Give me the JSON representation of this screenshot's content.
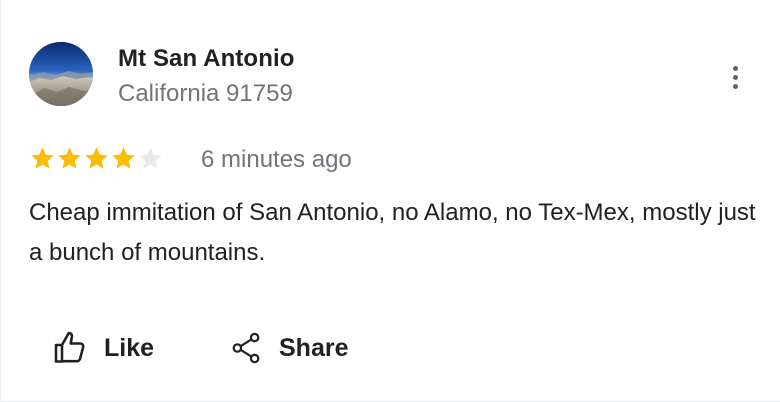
{
  "place": {
    "name": "Mt San Antonio",
    "subtitle": "California 91759"
  },
  "review": {
    "rating": 4,
    "max_rating": 5,
    "time_ago": "6 minutes ago",
    "text": "Cheap immitation of San Antonio, no Alamo, no Tex-Mex, mostly just a bunch of mountains."
  },
  "actions": {
    "like_label": "Like",
    "share_label": "Share"
  },
  "icons": {
    "avatar": "mountain-photo",
    "more": "more-vert-icon",
    "like": "thumb-up-icon",
    "share": "share-icon",
    "star_filled": "star-icon",
    "star_empty": "star-outline-icon"
  },
  "colors": {
    "star_filled": "#fbbc04",
    "star_empty": "#e8eaed",
    "text_primary": "#202124",
    "text_secondary": "#70757a"
  }
}
